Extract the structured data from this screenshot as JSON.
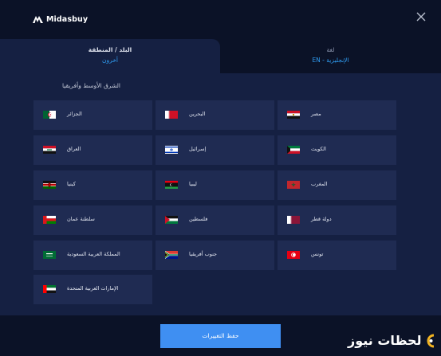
{
  "header": {
    "brand": "Midasbuy"
  },
  "tabs": [
    {
      "title": "البلد / المنطقة",
      "value": "أخرون",
      "active": true
    },
    {
      "title": "لغة",
      "value": "EN - الإنجليزية",
      "active": false
    }
  ],
  "region": {
    "section_title": "الشرق الأوسط وأفريقيا",
    "countries": [
      {
        "name": "مصر",
        "flag": "egypt-flag"
      },
      {
        "name": "البحرين",
        "flag": "bahrain-flag"
      },
      {
        "name": "الجزائر",
        "flag": "algeria-flag"
      },
      {
        "name": "الكويت",
        "flag": "kuwait-flag"
      },
      {
        "name": "إسرائيل",
        "flag": "israel-flag"
      },
      {
        "name": "العراق",
        "flag": "iraq-flag"
      },
      {
        "name": "المغرب",
        "flag": "morocco-flag"
      },
      {
        "name": "ليبيا",
        "flag": "libya-flag"
      },
      {
        "name": "كينيا",
        "flag": "kenya-flag"
      },
      {
        "name": "دولة قطر",
        "flag": "qatar-flag"
      },
      {
        "name": "فلسطين",
        "flag": "palestine-flag"
      },
      {
        "name": "سلطنة عمان",
        "flag": "oman-flag"
      },
      {
        "name": "تونس",
        "flag": "tunisia-flag"
      },
      {
        "name": "جنوب أفريقيا",
        "flag": "south-africa-flag"
      },
      {
        "name": "المملكة العربية السعودية",
        "flag": "saudi-arabia-flag"
      },
      {
        "name": "الإمارات العربية المتحدة",
        "flag": "uae-flag"
      }
    ]
  },
  "footer": {
    "save_label": "حفظ التغييرات"
  },
  "watermark": {
    "text": "لحظات نيوز"
  },
  "colors": {
    "background": "#0b1227",
    "panel": "#152042",
    "card": "#1f2b52",
    "accent": "#3f8ff2",
    "link": "#2f9df2"
  }
}
